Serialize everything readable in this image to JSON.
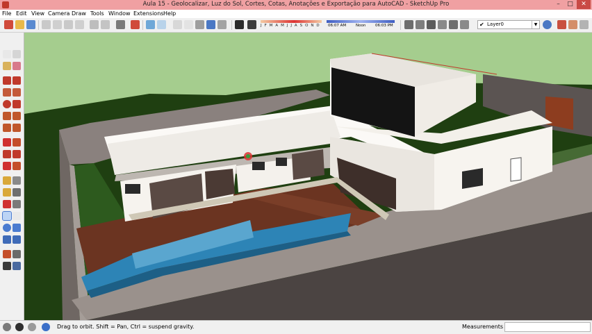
{
  "window": {
    "title": "Aula 15 - Geolocalizar, Luz do Sol, Cortes, Cotas, Anotações e Exportação para AutoCAD - SketchUp Pro",
    "minimize": "–",
    "maximize": "□",
    "close": "✕"
  },
  "menu": [
    "File",
    "Edit",
    "View",
    "Camera",
    "Draw",
    "Tools",
    "Window",
    "Extensions",
    "Help"
  ],
  "shadows": {
    "months_label": "J F M A M J J A S O N D",
    "time_start": "06:07 AM",
    "time_mid": "Noon",
    "time_end": "06:03 PM"
  },
  "layers": {
    "current_layer": "Layer0",
    "check": "✔",
    "dropdown_arrow": "▼"
  },
  "status": {
    "message": "Drag to orbit.  Shift = Pan, Ctrl = suspend gravity.",
    "measurements_label": "Measurements",
    "measurements_value": ""
  },
  "colors": {
    "sky": "#a5cd8e",
    "grass": "#1f3f11",
    "wall": "#8a817e",
    "house_white": "#fbf9f6",
    "deck": "#6b3421",
    "pool": "#2d84b6",
    "glass": "#141414"
  },
  "icons": {
    "toolbar": [
      "new-icon",
      "open-icon",
      "save-icon",
      "cut-icon",
      "copy-icon",
      "paste-icon",
      "erase-icon",
      "undo-icon",
      "redo-icon",
      "print-icon",
      "model-info-icon",
      "iso-view-icon",
      "top-view-icon",
      "front-view-icon",
      "right-view-icon",
      "back-view-icon",
      "left-view-icon",
      "xray-icon",
      "wireframe-icon",
      "hidden-line-icon",
      "shaded-icon",
      "shaded-texture-icon",
      "monochrome-icon",
      "shadows-icon",
      "fog-icon",
      "components-icon",
      "warehouse-icon",
      "extension-icon",
      "share-icon",
      "layers-icon",
      "section-plane-icon",
      "section-fill-icon",
      "display-section-icon"
    ],
    "palette": [
      "select-icon",
      "make-component-icon",
      "paint-bucket-icon",
      "eraser-icon",
      "line-icon",
      "freehand-icon",
      "rectangle-icon",
      "rotated-rectangle-icon",
      "circle-icon",
      "polygon-icon",
      "arc-icon",
      "pie-icon",
      "two-point-arc-icon",
      "three-point-arc-icon",
      "move-icon",
      "push-pull-icon",
      "rotate-icon",
      "follow-me-icon",
      "scale-icon",
      "offset-icon",
      "tape-measure-icon",
      "dimension-icon",
      "protractor-icon",
      "text-icon",
      "axes-icon",
      "3d-text-icon",
      "orbit-icon",
      "pan-icon",
      "zoom-icon",
      "zoom-window-icon",
      "zoom-extents-icon",
      "previous-view-icon",
      "position-camera-icon",
      "look-around-icon",
      "walk-icon",
      "section-plane-icon"
    ],
    "status": [
      "geo-location-icon",
      "credits-icon",
      "help-icon"
    ]
  }
}
